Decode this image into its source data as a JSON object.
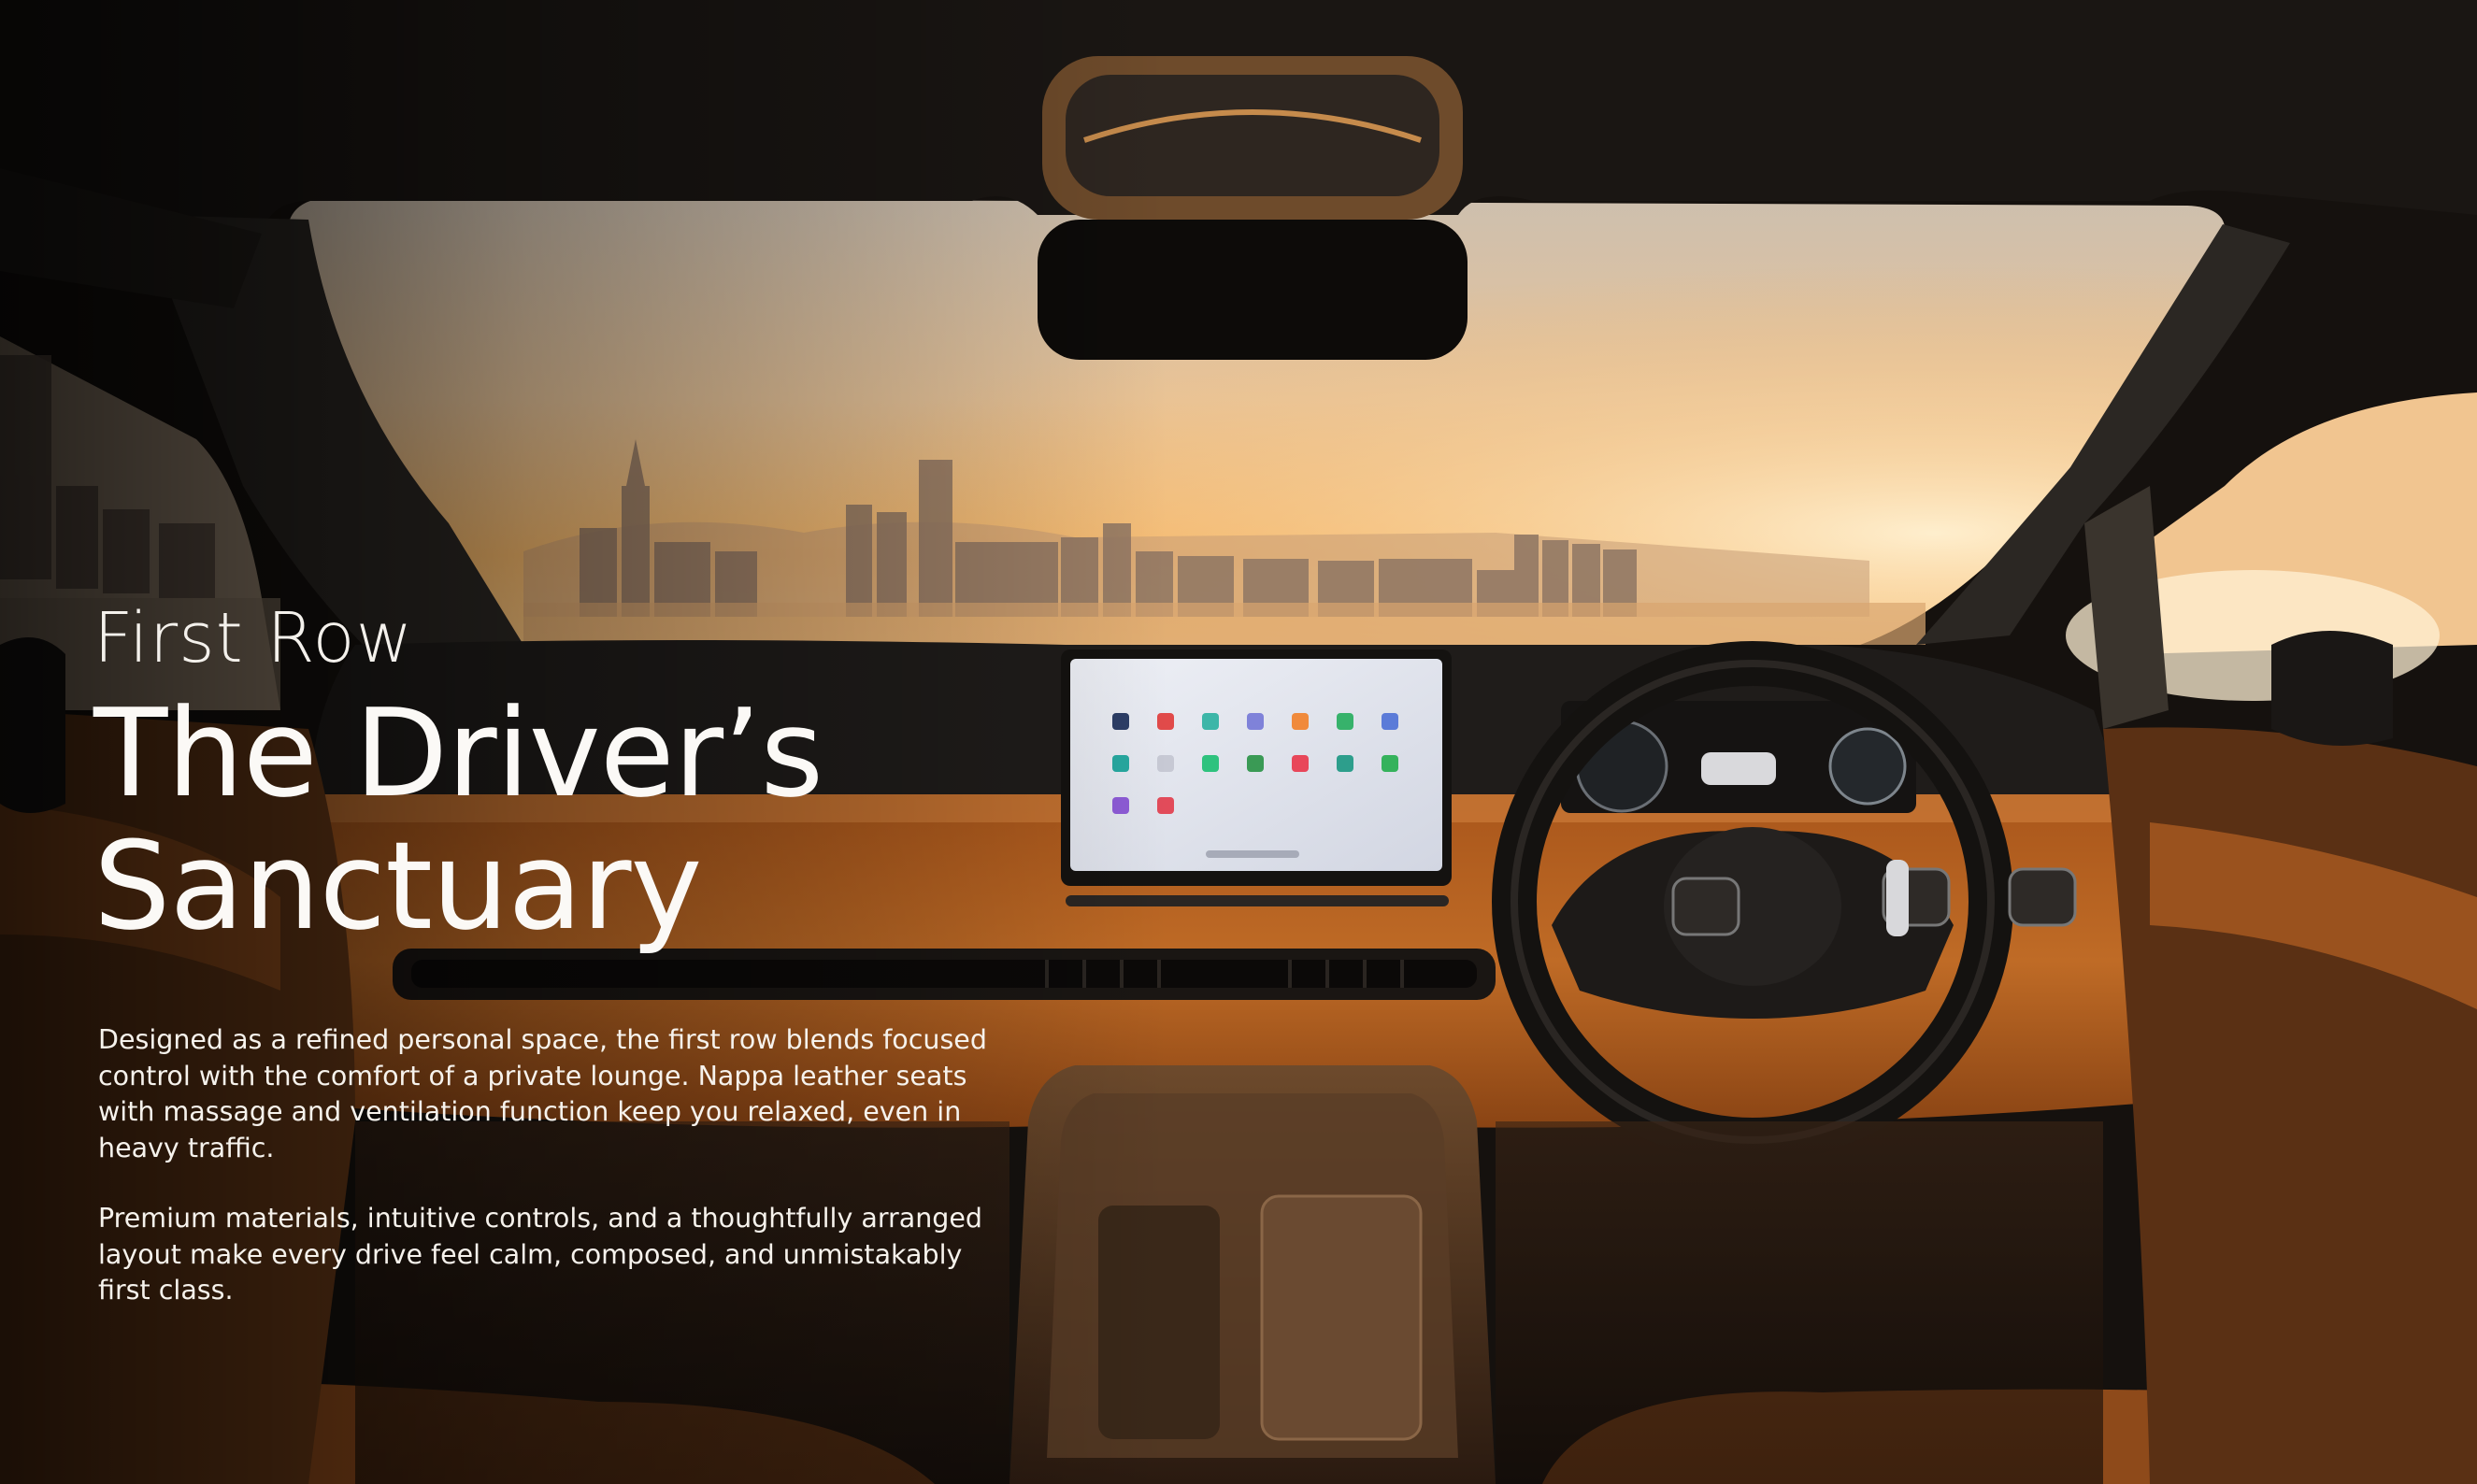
{
  "page": {
    "eyebrow": "First Row",
    "headline_line1": "The Driver’s",
    "headline_line2": "Sanctuary",
    "paragraph1": "Designed as a refined personal space, the first row blends focused control with the comfort of a private lounge. Nappa leather seats with massage and ventilation function keep you relaxed, even in heavy traffic.",
    "paragraph2": "Premium materials, intuitive controls, and a thoughtfully arranged layout make every drive feel calm, composed, and unmistakably first class."
  },
  "colors": {
    "leather": "#b8621e",
    "sky_top": "#c9b9a4",
    "sky_glow": "#f3b566",
    "cabin_dark": "#1b1815"
  },
  "icons": [
    "steering-wheel-icon",
    "infotainment-app-icons"
  ]
}
